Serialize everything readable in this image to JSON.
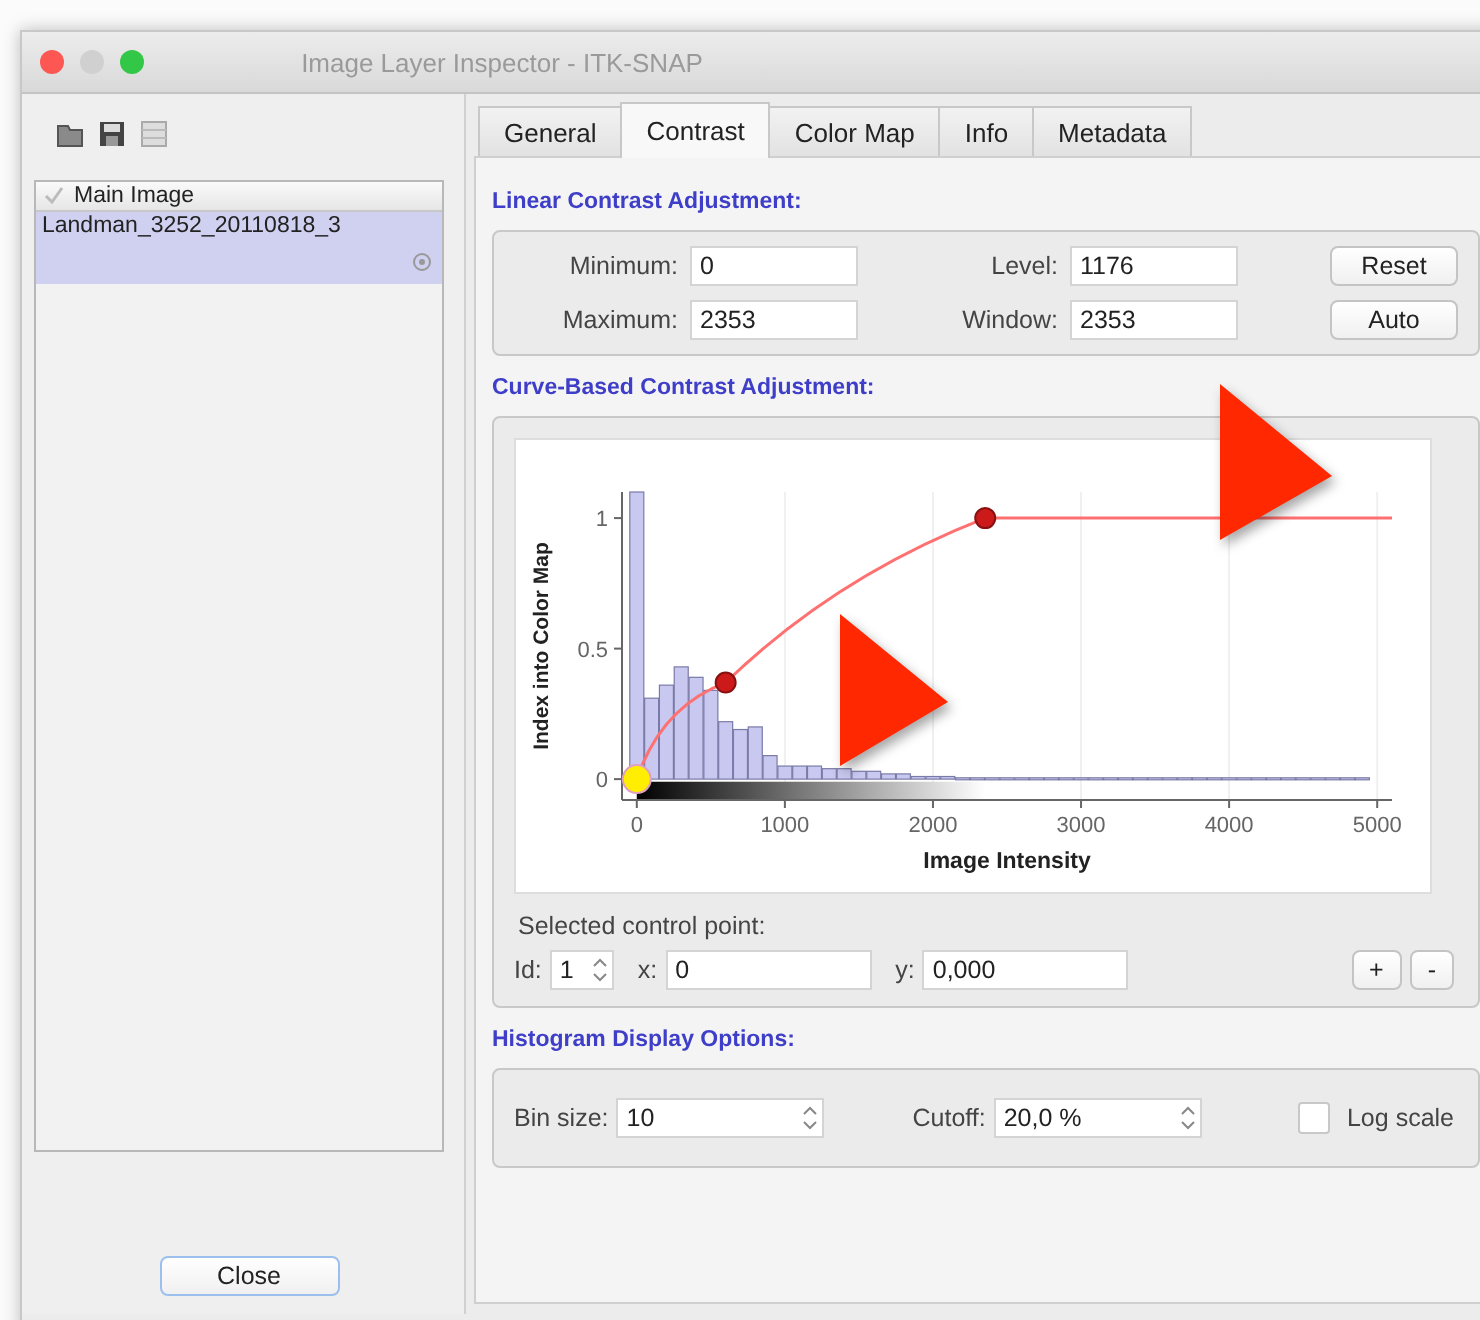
{
  "window": {
    "title": "Image Layer Inspector - ITK-SNAP"
  },
  "layer_list": {
    "header": "Main Image",
    "items": [
      {
        "name": "Landman_3252_20110818_3",
        "selected": true
      }
    ]
  },
  "close_button": "Close",
  "tabs": [
    {
      "label": "General",
      "selected": false
    },
    {
      "label": "Contrast",
      "selected": true
    },
    {
      "label": "Color Map",
      "selected": false
    },
    {
      "label": "Info",
      "selected": false
    },
    {
      "label": "Metadata",
      "selected": false
    }
  ],
  "linear": {
    "title": "Linear Contrast Adjustment:",
    "fields": [
      {
        "label": "Minimum:",
        "value": "0"
      },
      {
        "label": "Level:",
        "value": "1176"
      },
      {
        "label": "Maximum:",
        "value": "2353"
      },
      {
        "label": "Window:",
        "value": "2353"
      }
    ],
    "buttons": [
      "Reset",
      "Auto"
    ]
  },
  "curve": {
    "title": "Curve-Based Contrast Adjustment:",
    "chart_data": {
      "type": "bar",
      "xlabel": "Image Intensity",
      "ylabel": "Index into Color Map",
      "xlim": [
        -100,
        5100
      ],
      "ylim": [
        -0.08,
        1.1
      ],
      "xticks": [
        0,
        1000,
        2000,
        3000,
        4000,
        5000
      ],
      "yticks": [
        0,
        0.5,
        {
          "value": 1,
          "label": "1"
        }
      ],
      "grid": true,
      "series": [
        {
          "color": "#c8c8f0",
          "x": [
            0,
            100,
            200,
            300,
            400,
            500,
            600,
            700,
            800,
            900,
            1000,
            1100,
            1200,
            1300,
            1400,
            1500,
            1600,
            1700,
            1800,
            1900,
            2000,
            2100,
            2200,
            2300,
            2400,
            2500,
            2600,
            2700,
            2800,
            2900,
            3000,
            3100,
            3200,
            3300,
            3400,
            3500,
            3600,
            3700,
            3800,
            3900,
            4000,
            4100,
            4200,
            4300,
            4400,
            4500,
            4600,
            4700,
            4800,
            4900
          ],
          "values": [
            1.1,
            0.31,
            0.36,
            0.43,
            0.39,
            0.34,
            0.22,
            0.19,
            0.2,
            0.09,
            0.05,
            0.05,
            0.05,
            0.04,
            0.04,
            0.03,
            0.03,
            0.02,
            0.02,
            0.01,
            0.01,
            0.01,
            0.005,
            0.005,
            0.005,
            0.005,
            0.005,
            0.005,
            0.005,
            0.005,
            0.005,
            0.005,
            0.005,
            0.005,
            0.005,
            0.005,
            0.005,
            0.005,
            0.005,
            0.005,
            0.005,
            0.005,
            0.005,
            0.005,
            0.005,
            0.005,
            0.005,
            0.005,
            0.005,
            0.005
          ]
        },
        {
          "type": "line",
          "color": "#ff7070",
          "x": [
            0,
            600,
            2353,
            5100
          ],
          "values": [
            0,
            0.37,
            1,
            1
          ]
        }
      ]
    },
    "control_points": [
      {
        "selected": true
      },
      {
        "selected": false
      },
      {
        "selected": false
      }
    ],
    "selected_label": "Selected control point:",
    "id": {
      "label": "Id:",
      "value": "1"
    },
    "x": {
      "label": "x:",
      "value": "0"
    },
    "y": {
      "label": "y:",
      "value": "0,000"
    },
    "buttons": [
      "+",
      "-"
    ]
  },
  "histogram": {
    "title": "Histogram Display Options:",
    "bin_size": {
      "label": "Bin size:",
      "value": "10"
    },
    "cutoff": {
      "label": "Cutoff:",
      "value": "20,0 %"
    },
    "log_scale": {
      "label": "Log scale",
      "checked": false
    }
  }
}
